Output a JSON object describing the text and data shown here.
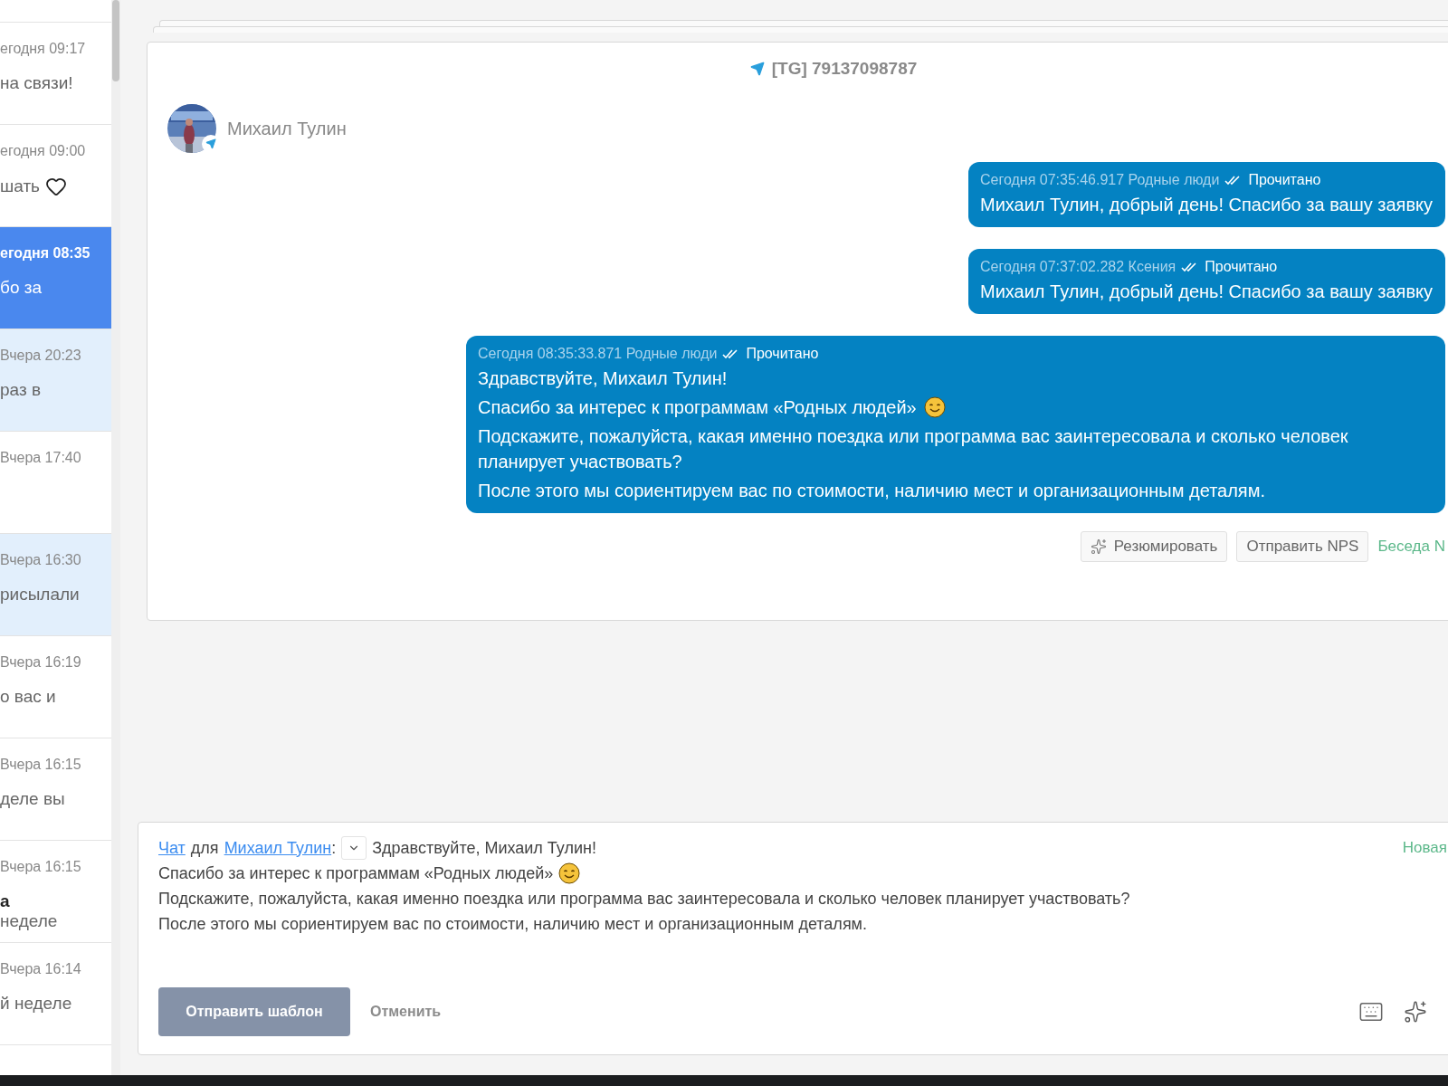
{
  "sidebar": {
    "items": [
      {
        "time": "егодня 09:17",
        "lines": [
          {
            "text": "на связи!",
            "bold": false
          }
        ],
        "heart": false,
        "selected": false,
        "unread": false
      },
      {
        "time": "егодня 09:00",
        "lines": [
          {
            "text": "шать",
            "bold": false
          }
        ],
        "heart": true,
        "selected": false,
        "unread": false
      },
      {
        "time": "егодня 08:35",
        "lines": [
          {
            "text": "бо за",
            "bold": false
          }
        ],
        "heart": false,
        "selected": true,
        "unread": false
      },
      {
        "time": "Вчера 20:23",
        "lines": [
          {
            "text": "раз в",
            "bold": false
          }
        ],
        "heart": false,
        "selected": false,
        "unread": true
      },
      {
        "time": "Вчера 17:40",
        "heart": false,
        "selected": false,
        "unread": false
      },
      {
        "time": "Вчера 16:30",
        "lines": [
          {
            "text": "рисылали",
            "bold": false
          }
        ],
        "heart": false,
        "selected": false,
        "unread": true
      },
      {
        "time": "Вчера 16:19",
        "lines": [
          {
            "text": "о вас и",
            "bold": false
          }
        ],
        "heart": false,
        "selected": false,
        "unread": false
      },
      {
        "time": "Вчера 16:15",
        "lines": [
          {
            "text": "деле вы",
            "bold": false
          }
        ],
        "heart": false,
        "selected": false,
        "unread": false
      },
      {
        "time": "Вчера 16:15",
        "lines": [
          {
            "text": "а",
            "bold": true
          },
          {
            "text": "неделе",
            "bold": false
          }
        ],
        "heart": false,
        "selected": false,
        "unread": false
      },
      {
        "time": "Вчера 16:14",
        "lines": [
          {
            "text": "й неделе",
            "bold": false
          }
        ],
        "heart": false,
        "selected": false,
        "unread": false
      }
    ]
  },
  "chat": {
    "channel": "[TG] 79137098787",
    "contact": "Михаил Тулин",
    "messages": [
      {
        "meta": "Сегодня 07:35:46.917 Родные люди",
        "status": "Прочитано",
        "read": true,
        "lines": [
          {
            "text": "Михаил Тулин, добрый день! Спасибо за вашу заявку"
          }
        ]
      },
      {
        "meta": "Сегодня 07:37:02.282 Ксения",
        "status": "Прочитано",
        "read": true,
        "lines": [
          {
            "text": "Михаил Тулин, добрый день! Спасибо за вашу заявку"
          }
        ]
      },
      {
        "meta": "Сегодня 08:35:33.871 Родные люди",
        "status": "Прочитано",
        "read": true,
        "lines": [
          {
            "text": "Здравствуйте, Михаил Тулин!"
          },
          {
            "text": "Спасибо за интерес к программам «Родных людей»",
            "smiley": true
          },
          {
            "text": "Подскажите, пожалуйста, какая именно поездка или программа вас заинтересовала и сколько человек планирует участвовать?"
          },
          {
            "text": "После этого мы сориентируем вас по стоимости, наличию мест и организационным деталям."
          }
        ]
      }
    ],
    "actions": {
      "summarize": "Резюмировать",
      "nps": "Отправить NPS",
      "conversation": "Беседа N"
    }
  },
  "composer": {
    "chat_link": "Чат",
    "for_text": "для",
    "recipient_link": "Михаил Тулин",
    "colon": ":",
    "status": "Новая",
    "lines": [
      {
        "text": "Здравствуйте, Михаил Тулин!"
      },
      {
        "text": "Спасибо за интерес к программам «Родных людей»",
        "smiley": true
      },
      {
        "text": "Подскажите, пожалуйста, какая именно поездка или программа вас заинтересовала и сколько человек планирует участвовать?"
      },
      {
        "text": "После этого мы сориентируем вас по стоимости, наличию мест и организационным деталям."
      }
    ],
    "send_button": "Отправить шаблон",
    "cancel_button": "Отменить"
  }
}
